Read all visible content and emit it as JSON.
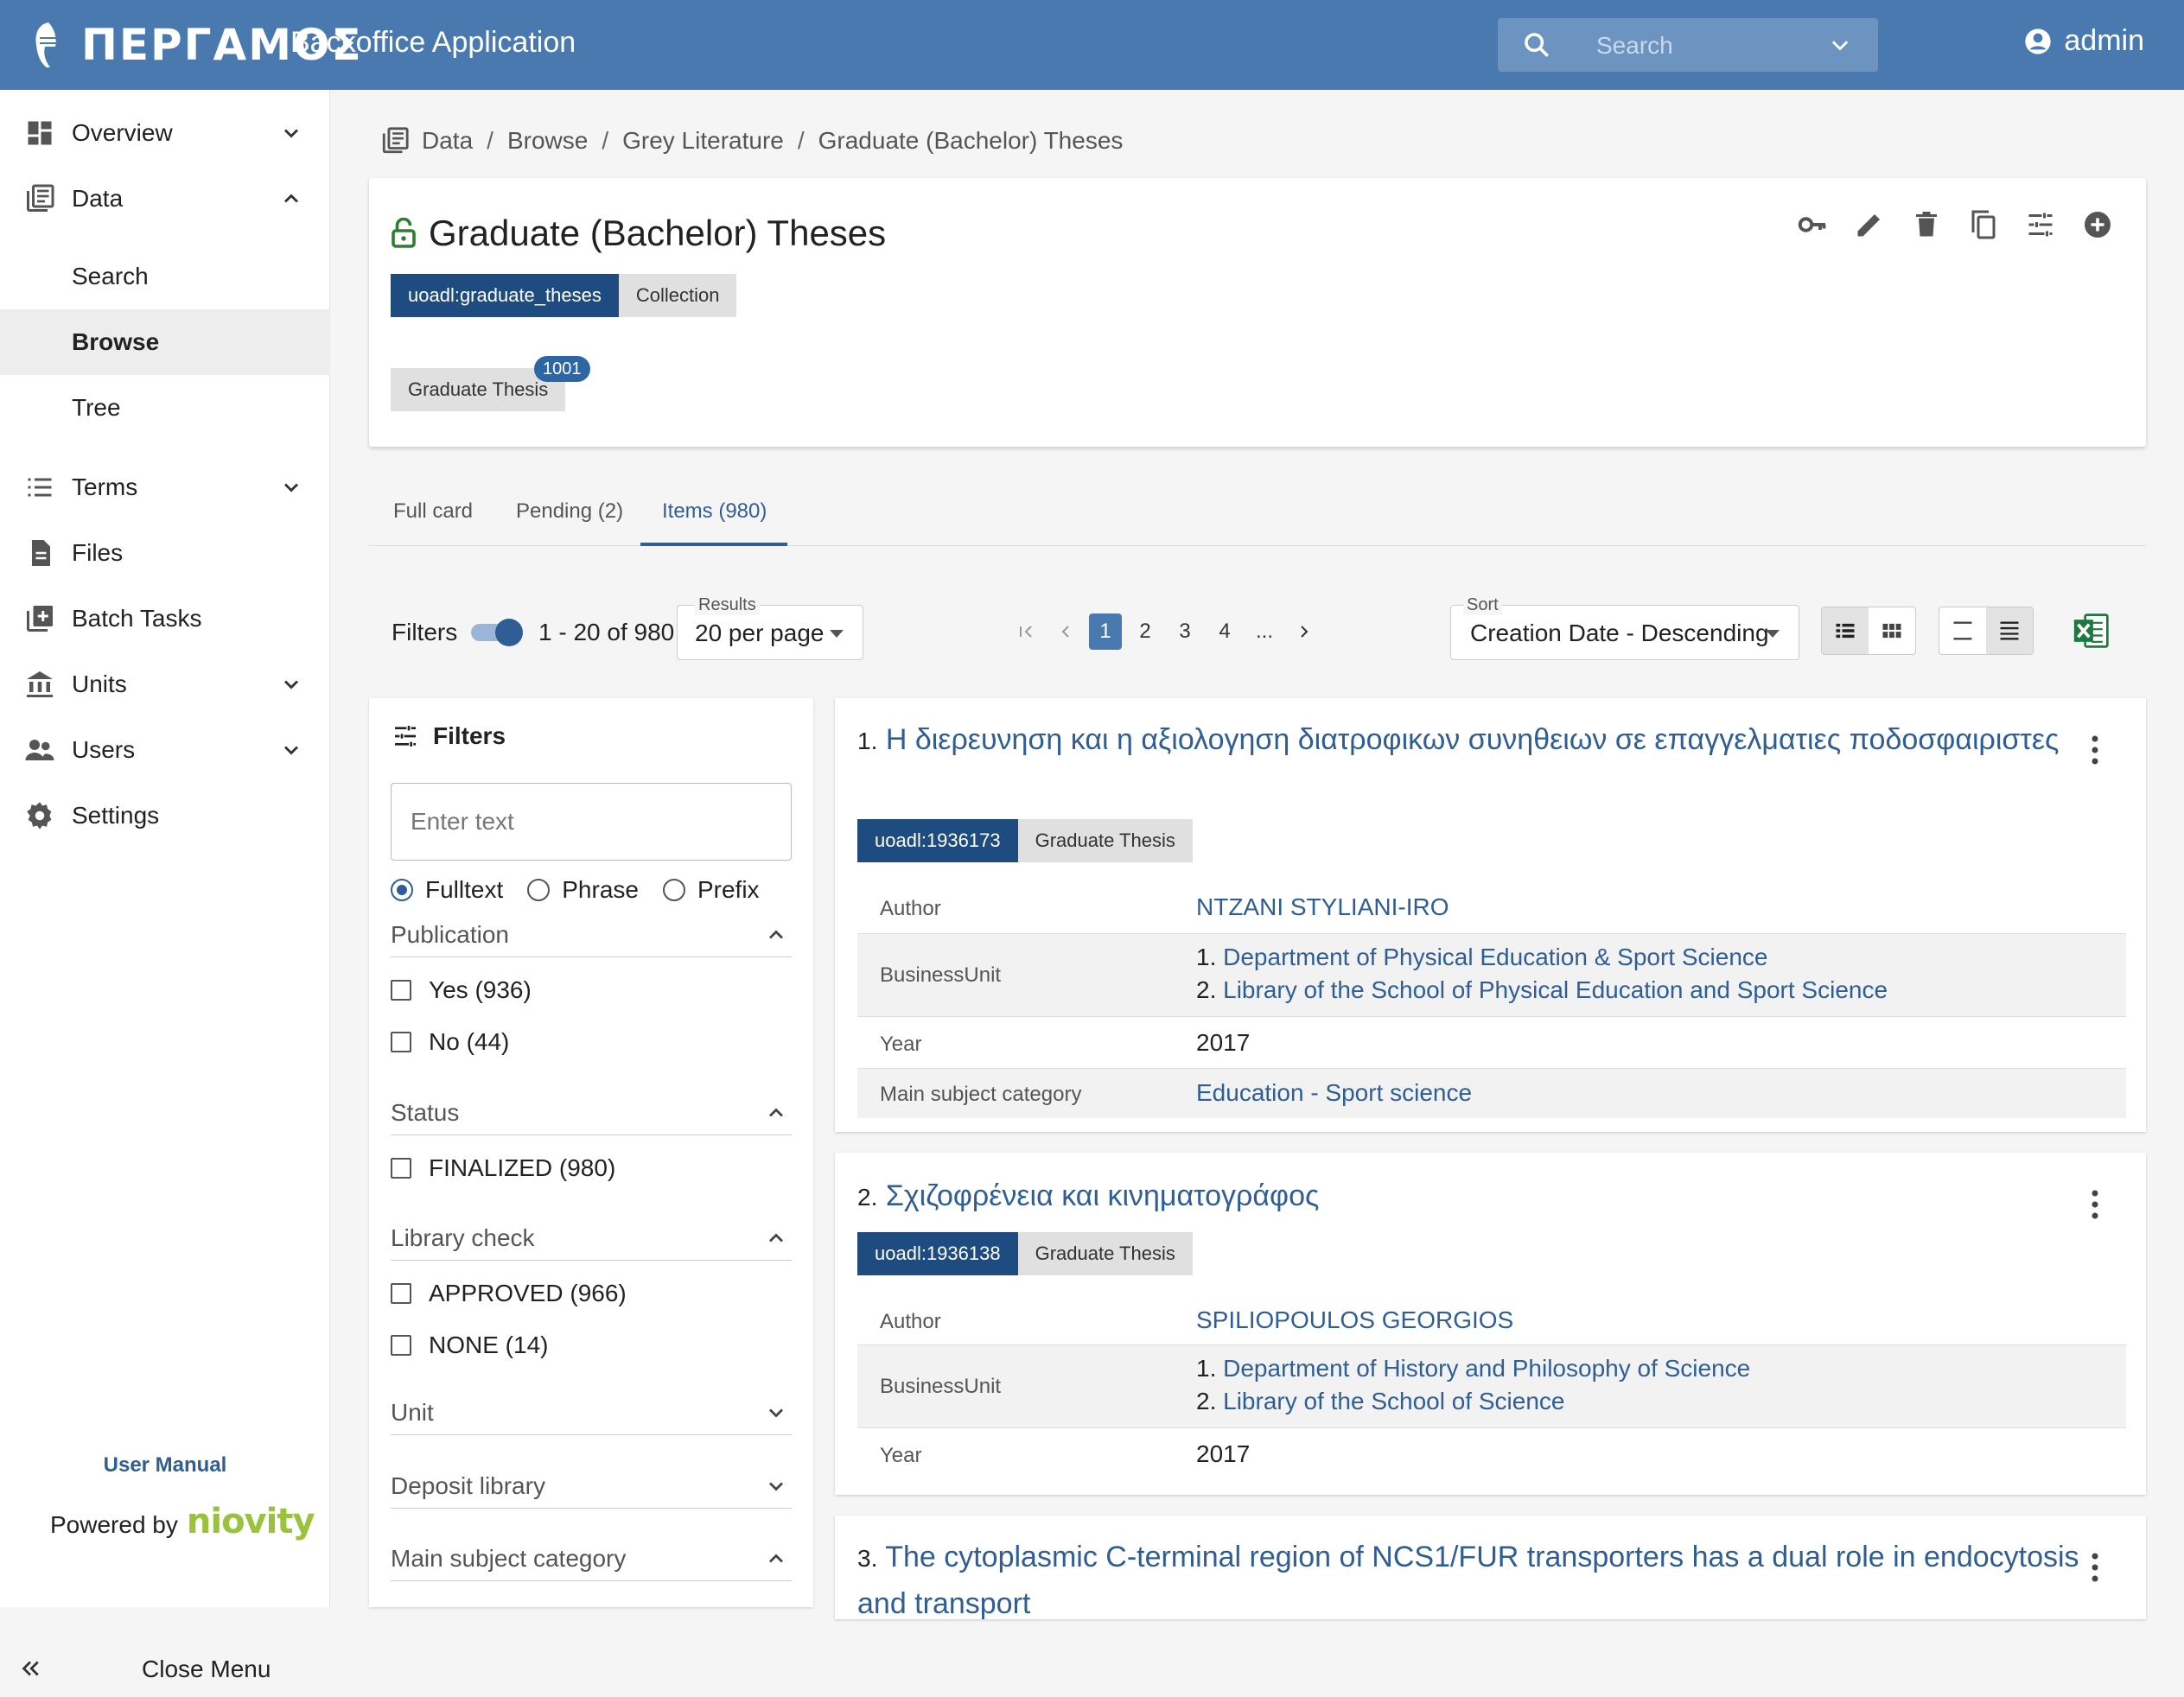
{
  "header": {
    "logo_text": "ΠΕΡΓΑΜΟΣ",
    "app_title": "Backoffice Application",
    "search_placeholder": "Search",
    "user_name": "admin",
    "brand_color": "#4a79b0"
  },
  "sidebar": {
    "items": [
      {
        "label": "Overview",
        "icon": "dashboard-icon"
      },
      {
        "label": "Data",
        "icon": "library-books-icon"
      },
      {
        "label": "Terms",
        "icon": "list-icon"
      },
      {
        "label": "Files",
        "icon": "file-icon"
      },
      {
        "label": "Batch Tasks",
        "icon": "add-box-icon"
      },
      {
        "label": "Units",
        "icon": "institution-icon"
      },
      {
        "label": "Users",
        "icon": "people-icon"
      },
      {
        "label": "Settings",
        "icon": "gear-icon"
      }
    ],
    "data_subitems": [
      "Search",
      "Browse",
      "Tree"
    ],
    "user_manual": "User Manual",
    "powered_by": "Powered by",
    "brand": "niovity",
    "close_menu": "Close Menu"
  },
  "breadcrumb": [
    "Data",
    "Browse",
    "Grey Literature",
    "Graduate (Bachelor) Theses"
  ],
  "collection": {
    "title": "Graduate (Bachelor) Theses",
    "id_chip": "uoadl:graduate_theses",
    "type_chip": "Collection",
    "item_type": "Graduate Thesis",
    "item_type_count": "1001"
  },
  "tabs": [
    "Full card",
    "Pending (2)",
    "Items (980)"
  ],
  "controls": {
    "filters_label": "Filters",
    "range_text": "1 - 20 of 980",
    "results_label": "Results",
    "results_value": "20 per page",
    "pages": [
      "1",
      "2",
      "3",
      "4",
      "..."
    ],
    "sort_label": "Sort",
    "sort_value": "Creation Date - Descending"
  },
  "filters": {
    "title": "Filters",
    "text_placeholder": "Enter text",
    "modes": [
      "Fulltext",
      "Phrase",
      "Prefix"
    ],
    "sections": {
      "publication": {
        "title": "Publication",
        "options": [
          "Yes (936)",
          "No (44)"
        ]
      },
      "status": {
        "title": "Status",
        "options": [
          "FINALIZED (980)"
        ]
      },
      "library_check": {
        "title": "Library check",
        "options": [
          "APPROVED (966)",
          "NONE (14)"
        ]
      },
      "unit": {
        "title": "Unit"
      },
      "deposit_library": {
        "title": "Deposit library"
      },
      "main_subject": {
        "title": "Main subject category"
      }
    }
  },
  "results": [
    {
      "num": "1.",
      "title": "Η διερευνηση και η αξιολογηση διατροφικων συνηθειων σε επαγγελματιες ποδοσφαιριστες",
      "id_chip": "uoadl:1936173",
      "type_chip": "Graduate Thesis",
      "author_label": "Author",
      "author": "NTZANI STYLIANI-IRO",
      "bu_label": "BusinessUnit",
      "bu1": "Department of Physical Education & Sport Science",
      "bu2": "Library of the School of Physical Education and Sport Science",
      "year_label": "Year",
      "year": "2017",
      "subject_label": "Main subject category",
      "subject": "Education - Sport science"
    },
    {
      "num": "2.",
      "title": "Σχιζοφρένεια και κινηματογράφος",
      "id_chip": "uoadl:1936138",
      "type_chip": "Graduate Thesis",
      "author_label": "Author",
      "author": "SPILIOPOULOS GEORGIOS",
      "bu_label": "BusinessUnit",
      "bu1": "Department of History and Philosophy of Science",
      "bu2": "Library of the School of Science",
      "year_label": "Year",
      "year": "2017"
    },
    {
      "num": "3.",
      "title": "The cytoplasmic C-terminal region of NCS1/FUR transporters has a dual role in endocytosis and transport"
    }
  ],
  "list_markers": [
    "1.",
    "2."
  ]
}
